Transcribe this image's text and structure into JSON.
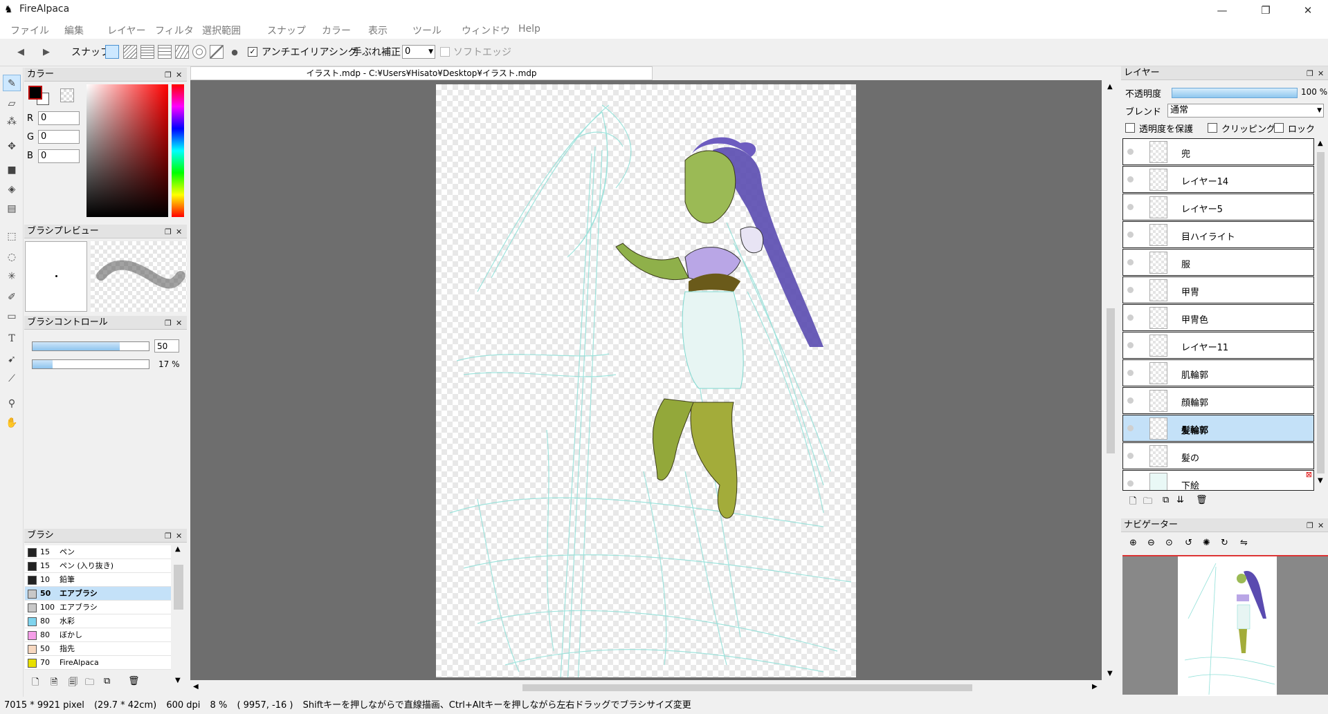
{
  "app": {
    "title": "FireAlpaca",
    "icon": "alpaca-icon"
  },
  "window_controls": {
    "minimize": "—",
    "restore": "❐",
    "close": "✕"
  },
  "menu": [
    "ファイル",
    "編集",
    "レイヤー",
    "フィルタ",
    "選択範囲",
    "スナップ",
    "カラー",
    "表示",
    "ツール",
    "ウィンドウ",
    "Help"
  ],
  "toolbar": {
    "snap_label": "スナップ",
    "antialias_label": "アンチエイリアシング",
    "antialias_checked": true,
    "stabilizer_label": "手ぶれ補正",
    "stabilizer_value": "0",
    "softedge_label": "ソフトエッジ",
    "softedge_checked": false
  },
  "document_tab": "イラスト.mdp - C:¥Users¥Hisato¥Desktop¥イラスト.mdp",
  "color_panel": {
    "title": "カラー",
    "r_label": "R",
    "r": "0",
    "g_label": "G",
    "g": "0",
    "b_label": "B",
    "b": "0",
    "primary_color": "#000000"
  },
  "brush_preview": {
    "title": "ブラシプレビュー"
  },
  "brush_control": {
    "title": "ブラシコントロール",
    "size": "50",
    "opacity": "17 %",
    "size_fraction": 0.75,
    "opacity_fraction": 0.17
  },
  "brush_panel": {
    "title": "ブラシ",
    "items": [
      {
        "size": "15",
        "name": "ペン",
        "color": "#222222"
      },
      {
        "size": "15",
        "name": "ペン (入り抜き)",
        "color": "#222222"
      },
      {
        "size": "10",
        "name": "鉛筆",
        "color": "#222222"
      },
      {
        "size": "50",
        "name": "エアブラシ",
        "color": "#c8c8c8",
        "selected": true
      },
      {
        "size": "100",
        "name": "エアブラシ",
        "color": "#c8c8c8"
      },
      {
        "size": "80",
        "name": "水彩",
        "color": "#7fd4ee"
      },
      {
        "size": "80",
        "name": "ぼかし",
        "color": "#f59ee8"
      },
      {
        "size": "50",
        "name": "指先",
        "color": "#f7d8c0"
      },
      {
        "size": "70",
        "name": "FireAlpaca",
        "color": "#e8e000"
      }
    ]
  },
  "layer_panel": {
    "title": "レイヤー",
    "opacity_label": "不透明度",
    "opacity_value": "100 %",
    "blend_label": "ブレンド",
    "blend_value": "通常",
    "protect_alpha_label": "透明度を保護",
    "clipping_label": "クリッピング",
    "lock_label": "ロック",
    "layers": [
      {
        "name": "兜"
      },
      {
        "name": "レイヤー14"
      },
      {
        "name": "レイヤー5"
      },
      {
        "name": "目ハイライト"
      },
      {
        "name": "服"
      },
      {
        "name": "甲冑"
      },
      {
        "name": "甲冑色"
      },
      {
        "name": "レイヤー11"
      },
      {
        "name": "肌輪郭"
      },
      {
        "name": "顔輪郭"
      },
      {
        "name": "髪輪郭",
        "selected": true
      },
      {
        "name": "髪の"
      },
      {
        "name": "下絵"
      }
    ]
  },
  "navigator": {
    "title": "ナビゲーター"
  },
  "status_bar": {
    "size": "7015 * 9921 pixel",
    "cm": "(29.7 * 42cm)",
    "dpi": "600 dpi",
    "zoom": "8 %",
    "coords": "( 9957, -16 )",
    "hint": "Shiftキーを押しながらで直線描画、Ctrl+Altキーを押しながら左右ドラッグでブラシサイズ変更"
  }
}
